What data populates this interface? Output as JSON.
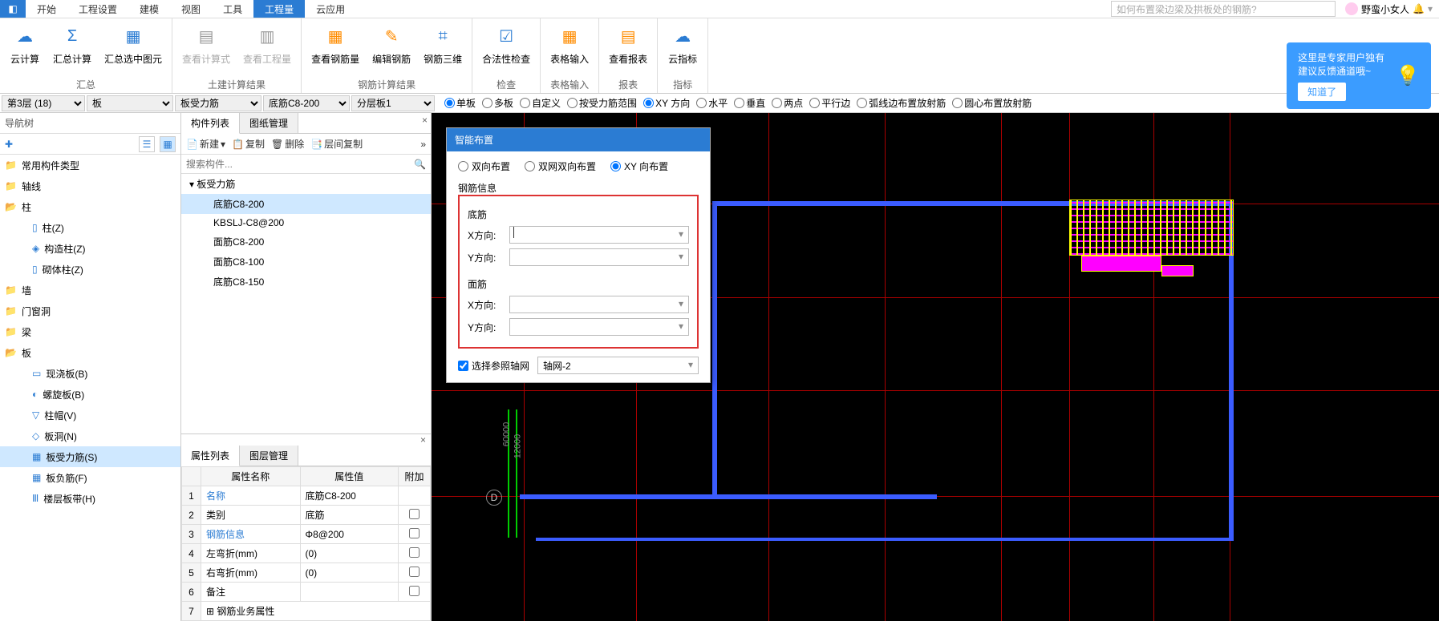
{
  "tabs": {
    "t0": "开始",
    "t1": "工程设置",
    "t2": "建模",
    "t3": "视图",
    "t4": "工具",
    "t5": "工程量",
    "t6": "云应用"
  },
  "search_placeholder": "如何布置梁边梁及拱板处的钢筋?",
  "user_name": "野蛮小女人",
  "ribbon": {
    "r0": "云计算",
    "r1": "汇总计算",
    "r2": "汇总选中图元",
    "r3": "查看计算式",
    "r4": "查看工程量",
    "r5": "查看钢筋量",
    "r6": "编辑钢筋",
    "r7": "钢筋三维",
    "r8": "合法性检查",
    "r9": "表格输入",
    "r10": "查看报表",
    "r11": "云指标",
    "g0": "汇总",
    "g1": "土建计算结果",
    "g2": "钢筋计算结果",
    "g3": "检查",
    "g4": "表格输入",
    "g5": "报表",
    "g6": "指标"
  },
  "tip": {
    "line1": "这里是专家用户独有",
    "line2": "建议反馈通道哦~",
    "btn": "知道了"
  },
  "filters": {
    "floor": "第3层 (18)",
    "cat": "板",
    "sub": "板受力筋",
    "item": "底筋C8-200",
    "layer": "分层板1",
    "o0": "单板",
    "o1": "多板",
    "o2": "自定义",
    "o3": "按受力筋范围",
    "o4": "XY 方向",
    "o5": "水平",
    "o6": "垂直",
    "o7": "两点",
    "o8": "平行边",
    "o9": "弧线边布置放射筋",
    "o10": "圆心布置放射筋"
  },
  "nav": {
    "title": "导航树",
    "n0": "常用构件类型",
    "n1": "轴线",
    "n2": "柱",
    "n2a": "柱(Z)",
    "n2b": "构造柱(Z)",
    "n2c": "砌体柱(Z)",
    "n3": "墙",
    "n4": "门窗洞",
    "n5": "梁",
    "n6": "板",
    "n6a": "现浇板(B)",
    "n6b": "螺旋板(B)",
    "n6c": "柱帽(V)",
    "n6d": "板洞(N)",
    "n6e": "板受力筋(S)",
    "n6f": "板负筋(F)",
    "n6g": "楼层板带(H)"
  },
  "comp": {
    "tab0": "构件列表",
    "tab1": "图纸管理",
    "new": "新建",
    "copy": "复制",
    "del": "删除",
    "layercopy": "层间复制",
    "search": "搜索构件...",
    "cat": "板受力筋",
    "i0": "底筋C8-200",
    "i1": "KBSLJ-C8@200",
    "i2": "面筋C8-200",
    "i3": "面筋C8-100",
    "i4": "底筋C8-150"
  },
  "prop": {
    "tab0": "属性列表",
    "tab1": "图层管理",
    "h0": "属性名称",
    "h1": "属性值",
    "h2": "附加",
    "r1n": "名称",
    "r1v": "底筋C8-200",
    "r2n": "类别",
    "r2v": "底筋",
    "r3n": "钢筋信息",
    "r3v": "Φ8@200",
    "r4n": "左弯折(mm)",
    "r4v": "(0)",
    "r5n": "右弯折(mm)",
    "r5v": "(0)",
    "r6n": "备注",
    "r6v": "",
    "r7n": "钢筋业务属性"
  },
  "dialog": {
    "title": "智能布置",
    "opt0": "双向布置",
    "opt1": "双网双向布置",
    "opt2": "XY 向布置",
    "section": "钢筋信息",
    "grp0": "底筋",
    "grp1": "面筋",
    "xlbl": "X方向:",
    "ylbl": "Y方向:",
    "chk": "选择参照轴网",
    "axis": "轴网-2"
  },
  "axis": {
    "d": "D",
    "v1": "60000",
    "v2": "12000"
  }
}
